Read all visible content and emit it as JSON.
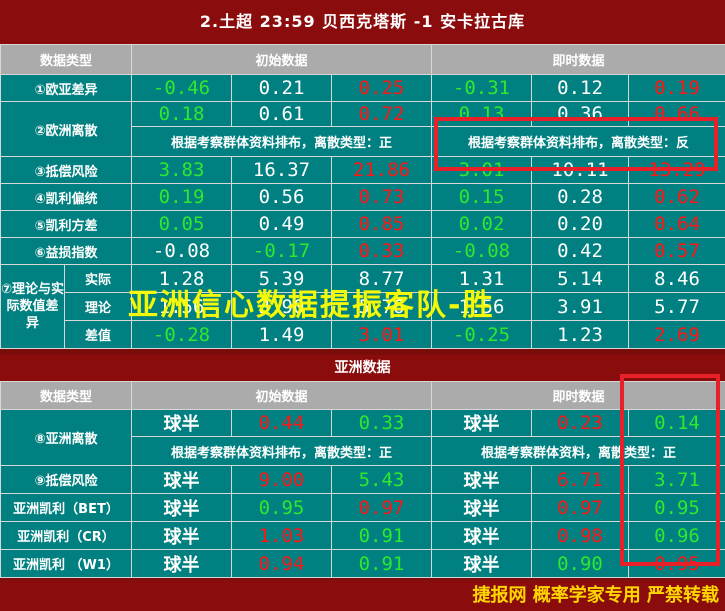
{
  "title": "2.土超 23:59  贝西克塔斯 -1 安卡拉古库",
  "europe": {
    "header": [
      "数据类型",
      "初始数据",
      "即时数据"
    ],
    "rows": [
      {
        "label": "①欧亚差异",
        "vals": [
          [
            "-0.46",
            "g"
          ],
          [
            "0.21",
            "w"
          ],
          [
            "0.25",
            "r"
          ],
          [
            "-0.31",
            "g"
          ],
          [
            "0.12",
            "w"
          ],
          [
            "0.19",
            "r"
          ]
        ]
      },
      {
        "label": "②欧洲离散",
        "vals": [
          [
            "0.18",
            "g"
          ],
          [
            "0.61",
            "w"
          ],
          [
            "0.72",
            "r"
          ],
          [
            "0.13",
            "g"
          ],
          [
            "0.36",
            "w"
          ],
          [
            "0.66",
            "r"
          ]
        ],
        "note_init": "根据考察群体资料排布，离散类型：正",
        "note_live": "根据考察群体资料排布，离散类型：反"
      },
      {
        "label": "③抵偿风险",
        "vals": [
          [
            "3.83",
            "g"
          ],
          [
            "16.37",
            "w"
          ],
          [
            "21.86",
            "r"
          ],
          [
            "3.01",
            "g"
          ],
          [
            "10.11",
            "w"
          ],
          [
            "13.29",
            "r"
          ]
        ]
      },
      {
        "label": "④凯利偏统",
        "vals": [
          [
            "0.19",
            "g"
          ],
          [
            "0.56",
            "w"
          ],
          [
            "0.73",
            "r"
          ],
          [
            "0.15",
            "g"
          ],
          [
            "0.28",
            "w"
          ],
          [
            "0.62",
            "r"
          ]
        ]
      },
      {
        "label": "⑤凯利方差",
        "vals": [
          [
            "0.05",
            "g"
          ],
          [
            "0.49",
            "w"
          ],
          [
            "0.85",
            "r"
          ],
          [
            "0.02",
            "g"
          ],
          [
            "0.20",
            "w"
          ],
          [
            "0.64",
            "r"
          ]
        ]
      },
      {
        "label": "⑥益损指数",
        "vals": [
          [
            "-0.08",
            "w"
          ],
          [
            "-0.17",
            "g"
          ],
          [
            "0.33",
            "r"
          ],
          [
            "-0.08",
            "g"
          ],
          [
            "0.42",
            "w"
          ],
          [
            "0.57",
            "r"
          ]
        ]
      }
    ],
    "theory": {
      "label": "⑦理论与实际数值差异",
      "rows": [
        {
          "sub": "实际",
          "vals": [
            [
              "1.28",
              "w"
            ],
            [
              "5.39",
              "w"
            ],
            [
              "8.77",
              "w"
            ],
            [
              "1.31",
              "w"
            ],
            [
              "5.14",
              "w"
            ],
            [
              "8.46",
              "w"
            ]
          ]
        },
        {
          "sub": "理论",
          "vals": [
            [
              "1.56",
              "w"
            ],
            [
              "3.90",
              "w"
            ],
            [
              "5.76",
              "w"
            ],
            [
              "1.56",
              "w"
            ],
            [
              "3.91",
              "w"
            ],
            [
              "5.77",
              "w"
            ]
          ]
        },
        {
          "sub": "差值",
          "vals": [
            [
              "-0.28",
              "g"
            ],
            [
              "1.49",
              "w"
            ],
            [
              "3.01",
              "r"
            ],
            [
              "-0.25",
              "g"
            ],
            [
              "1.23",
              "w"
            ],
            [
              "2.69",
              "r"
            ]
          ]
        }
      ]
    }
  },
  "watermark": "亚洲信心数据提振客队-胜",
  "asia": {
    "section_title": "亚洲数据",
    "header": [
      "数据类型",
      "初始数据",
      "即时数据"
    ],
    "rows": [
      {
        "label": "⑧亚洲离散",
        "hcap_init": "球半",
        "init": [
          [
            "0.44",
            "r"
          ],
          [
            "0.33",
            "g"
          ]
        ],
        "hcap_live": "球半",
        "live": [
          [
            "0.23",
            "r"
          ],
          [
            "0.14",
            "g"
          ]
        ],
        "note_init": "根据考察群体资料排布，离散类型：正",
        "note_live": "根据考察群体资料，离散类型：正"
      },
      {
        "label": "⑨抵偿风险",
        "hcap_init": "球半",
        "init": [
          [
            "9.00",
            "r"
          ],
          [
            "5.43",
            "g"
          ]
        ],
        "hcap_live": "球半",
        "live": [
          [
            "6.71",
            "r"
          ],
          [
            "3.71",
            "g"
          ]
        ]
      },
      {
        "label": "亚洲凯利（BET）",
        "hcap_init": "球半",
        "init": [
          [
            "0.95",
            "g"
          ],
          [
            "0.97",
            "r"
          ]
        ],
        "hcap_live": "球半",
        "live": [
          [
            "0.97",
            "r"
          ],
          [
            "0.95",
            "g"
          ]
        ]
      },
      {
        "label": "亚洲凯利（CR）",
        "hcap_init": "球半",
        "init": [
          [
            "1.03",
            "r"
          ],
          [
            "0.91",
            "g"
          ]
        ],
        "hcap_live": "球半",
        "live": [
          [
            "0.98",
            "r"
          ],
          [
            "0.96",
            "g"
          ]
        ]
      },
      {
        "label": "亚洲凯利 （W1）",
        "hcap_init": "球半",
        "init": [
          [
            "0.94",
            "r"
          ],
          [
            "0.91",
            "g"
          ]
        ],
        "hcap_live": "球半",
        "live": [
          [
            "0.90",
            "g"
          ],
          [
            "0.95",
            "r"
          ]
        ]
      }
    ]
  },
  "footer": "捷报网  概率学家专用  严禁转载",
  "colors": {
    "frame": "#8b0c0c",
    "cell": "#008080",
    "header": "#ababab",
    "green": "#2ee82e",
    "red": "#ff1515",
    "highlight": "#e8202a",
    "footer_text": "#ffd700"
  }
}
